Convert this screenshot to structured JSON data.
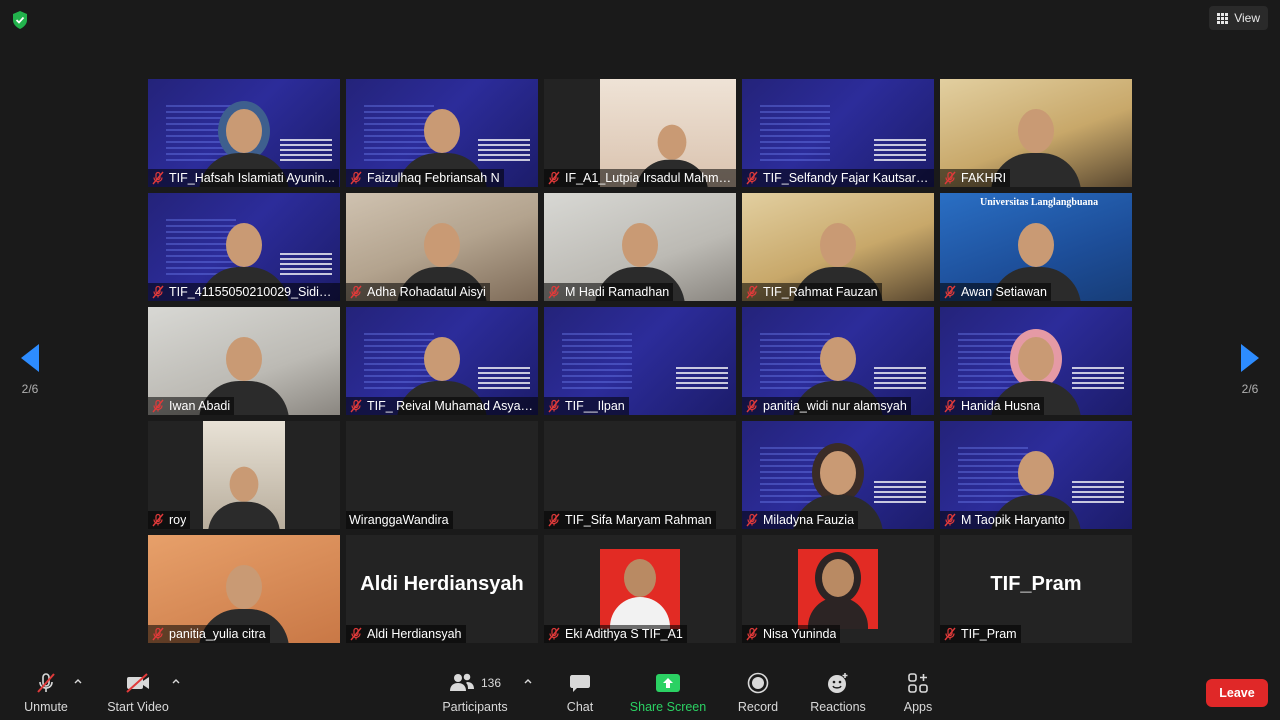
{
  "topbar": {
    "view_label": "View"
  },
  "pagination": {
    "left_label": "2/6",
    "right_label": "2/6"
  },
  "participants": [
    {
      "name": "TIF_Hafsah Islamiati Ayunin...",
      "muted": true,
      "scene": "slide",
      "person": "hijab"
    },
    {
      "name": "Faizulhaq Febriansah N",
      "muted": true,
      "scene": "slide",
      "person": "plain"
    },
    {
      "name": "IF_A1_Lutpia Irsadul Mahmud",
      "muted": true,
      "scene": "strip",
      "person": "plain"
    },
    {
      "name": "TIF_Selfandy Fajar Kautsara ...",
      "muted": true,
      "scene": "slide",
      "person": "none"
    },
    {
      "name": "FAKHRI",
      "muted": true,
      "scene": "warm",
      "person": "plain"
    },
    {
      "name": "TIF_41155050210029_Sidik P...",
      "muted": true,
      "scene": "slide",
      "person": "plain"
    },
    {
      "name": "Adha Rohadatul Aisyi",
      "muted": true,
      "scene": "room",
      "person": "plain"
    },
    {
      "name": "M Hadi Ramadhan",
      "muted": true,
      "scene": "wall",
      "person": "plain"
    },
    {
      "name": "TIF_Rahmat Fauzan",
      "muted": true,
      "scene": "warm",
      "person": "plain"
    },
    {
      "name": "Awan Setiawan",
      "muted": true,
      "scene": "univ",
      "person": "plain",
      "overlay": "Universitas Langlangbuana"
    },
    {
      "name": "Iwan Abadi",
      "muted": true,
      "scene": "wall",
      "person": "plain"
    },
    {
      "name": "TIF_ Reival Muhamad Asyari ...",
      "muted": true,
      "scene": "slide",
      "person": "plain"
    },
    {
      "name": "TIF__Ilpan",
      "muted": true,
      "scene": "slide",
      "person": "none"
    },
    {
      "name": "panitia_widi nur alamsyah",
      "muted": true,
      "scene": "slide",
      "person": "plain"
    },
    {
      "name": "Hanida Husna",
      "muted": true,
      "scene": "slide",
      "person": "hijab-pink"
    },
    {
      "name": "roy",
      "muted": true,
      "scene": "narrow",
      "person": "plain"
    },
    {
      "name": "WiranggaWandira",
      "muted": false,
      "scene": "dark",
      "person": "none"
    },
    {
      "name": "TIF_Sifa Maryam Rahman",
      "muted": true,
      "scene": "dark",
      "person": "none"
    },
    {
      "name": "Miladyna Fauzia",
      "muted": true,
      "scene": "slide",
      "person": "hijab-dark"
    },
    {
      "name": "M Taopik Haryanto",
      "muted": true,
      "scene": "slide",
      "person": "plain"
    },
    {
      "name": "panitia_yulia citra",
      "muted": true,
      "scene": "orange",
      "person": "plain"
    },
    {
      "name": "Aldi Herdiansyah",
      "muted": true,
      "scene": "name",
      "person": "none",
      "big_name": "Aldi Herdiansyah"
    },
    {
      "name": "Eki Adithya S TIF_A1",
      "muted": true,
      "scene": "photo-red",
      "person": "none"
    },
    {
      "name": "Nisa Yuninda",
      "muted": true,
      "scene": "photo-red-hijab",
      "person": "none"
    },
    {
      "name": "TIF_Pram",
      "muted": true,
      "scene": "name",
      "person": "none",
      "big_name": "TIF_Pram"
    }
  ],
  "toolbar": {
    "unmute": "Unmute",
    "start_video": "Start Video",
    "participants": "Participants",
    "participants_count": "136",
    "chat": "Chat",
    "share_screen": "Share Screen",
    "record": "Record",
    "reactions": "Reactions",
    "apps": "Apps",
    "leave": "Leave"
  },
  "colors": {
    "accent_blue": "#2d8cff",
    "share_green": "#2bd163",
    "leave_red": "#e02828",
    "muted_red": "#e03a3a"
  }
}
